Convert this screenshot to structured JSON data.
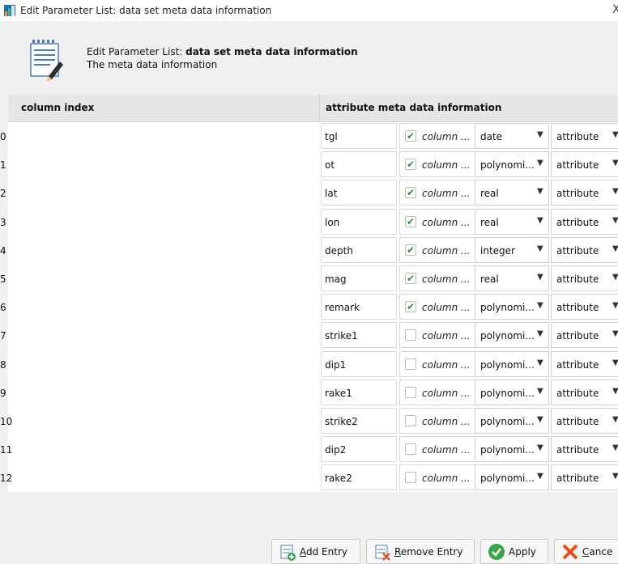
{
  "window": {
    "title": "Edit Parameter List: data set meta data information",
    "close_glyph": "X"
  },
  "header": {
    "line1_prefix": "Edit Parameter List: ",
    "line1_bold": "data set meta data information",
    "line2": "The meta data information",
    "icon": "notepad-pencil-icon"
  },
  "table": {
    "columns": [
      "column index",
      "attribute meta data information"
    ],
    "check_label": "column ...",
    "rows": [
      {
        "index": "0",
        "name": "tgl",
        "checked": true,
        "type": "date",
        "role": "attribute"
      },
      {
        "index": "1",
        "name": "ot",
        "checked": true,
        "type": "polynomi...",
        "role": "attribute"
      },
      {
        "index": "2",
        "name": "lat",
        "checked": true,
        "type": "real",
        "role": "attribute"
      },
      {
        "index": "3",
        "name": "lon",
        "checked": true,
        "type": "real",
        "role": "attribute"
      },
      {
        "index": "4",
        "name": "depth",
        "checked": true,
        "type": "integer",
        "role": "attribute"
      },
      {
        "index": "5",
        "name": "mag",
        "checked": true,
        "type": "real",
        "role": "attribute"
      },
      {
        "index": "6",
        "name": "remark",
        "checked": true,
        "type": "polynomi...",
        "role": "attribute"
      },
      {
        "index": "7",
        "name": "strike1",
        "checked": false,
        "type": "polynomi...",
        "role": "attribute"
      },
      {
        "index": "8",
        "name": "dip1",
        "checked": false,
        "type": "polynomi...",
        "role": "attribute"
      },
      {
        "index": "9",
        "name": "rake1",
        "checked": false,
        "type": "polynomi...",
        "role": "attribute"
      },
      {
        "index": "10",
        "name": "strike2",
        "checked": false,
        "type": "polynomi...",
        "role": "attribute"
      },
      {
        "index": "11",
        "name": "dip2",
        "checked": false,
        "type": "polynomi...",
        "role": "attribute"
      },
      {
        "index": "12",
        "name": "rake2",
        "checked": false,
        "type": "polynomi...",
        "role": "attribute"
      }
    ]
  },
  "buttons": {
    "add_mnemonic": "A",
    "add_rest": "dd Entry",
    "remove_mnemonic": "R",
    "remove_rest": "emove Entry",
    "apply": "Apply",
    "cancel_mnemonic": "C",
    "cancel_rest": "ance"
  },
  "colors": {
    "check": "#2f8f3f",
    "header_bg": "#e6e6e6",
    "apply_icon": "#3aa64a",
    "cancel_icon": "#e8501e"
  }
}
